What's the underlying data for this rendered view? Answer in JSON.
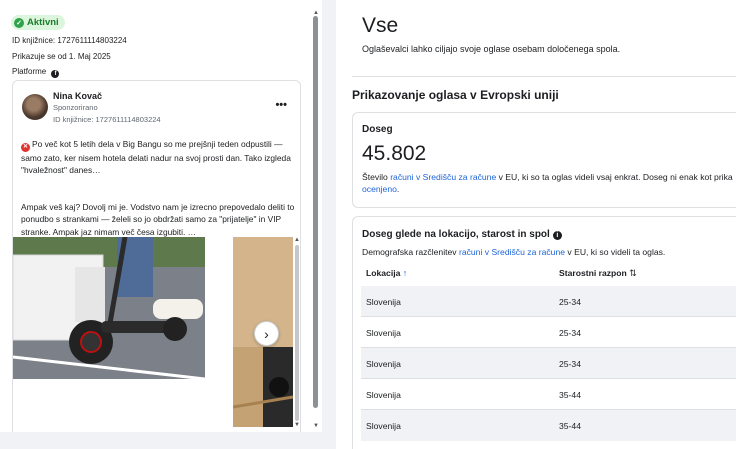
{
  "left": {
    "status_badge": "Aktivni",
    "library_id": "ID knjižnice: 1727611114803224",
    "running_since": "Prikazuje se od 1. Maj 2025",
    "platforms_label": "Platforme",
    "platform_icon": "facebook-icon"
  },
  "ad": {
    "advertiser": "Nina Kovač",
    "sponsored": "Sponzorirano",
    "library_id": "ID knjižnice: 1727611114803224",
    "more_label": "•••",
    "paragraph1": "Po več kot 5 letih dela v Big Bangu so me prejšnji teden odpustili — samo zato, ker nisem hotela delati nadur na svoj prosti dan. Tako izgleda \"hvaležnost\" danes…",
    "paragraph2": "Ampak veš kaj? Dovolj mi je. Vodstvo nam je izrecno prepovedalo deliti to ponudbo s strankami — želeli so jo obdržati samo za \"prijatelje\" in VIP stranke. Ampak jaz nimam več česa izgubiti. …",
    "next_label": "›"
  },
  "right": {
    "title": "Vse",
    "description": "Oglaševalci lahko ciljajo svoje oglase osebam določenega spola.",
    "eu_heading": "Prikazovanje oglasa v Evropski uniji",
    "reach": {
      "label": "Doseg",
      "value": "45.802",
      "note_prefix": "Število ",
      "note_link": "računi v Središču za račune",
      "note_mid": " v EU, ki so ta oglas videli vsaj enkrat. Doseg ni enak kot prika",
      "note_link2": "ocenjeno",
      "note_end": "."
    },
    "breakdown": {
      "title": "Doseg glede na lokacijo, starost in spol",
      "desc_prefix": "Demografska razčlenitev ",
      "desc_link": "računi v Središču za račune",
      "desc_suffix": " v EU, ki so videli ta oglas.",
      "col_location": "Lokacija",
      "col_age": "Starostni razpon",
      "rows": [
        {
          "location": "Slovenija",
          "age": "25-34"
        },
        {
          "location": "Slovenija",
          "age": "25-34"
        },
        {
          "location": "Slovenija",
          "age": "25-34"
        },
        {
          "location": "Slovenija",
          "age": "35-44"
        },
        {
          "location": "Slovenija",
          "age": "35-44"
        }
      ]
    }
  },
  "colors": {
    "accent_link": "#1d64d8",
    "active_green": "#31a24c",
    "page_bg": "#f0f2f5"
  }
}
